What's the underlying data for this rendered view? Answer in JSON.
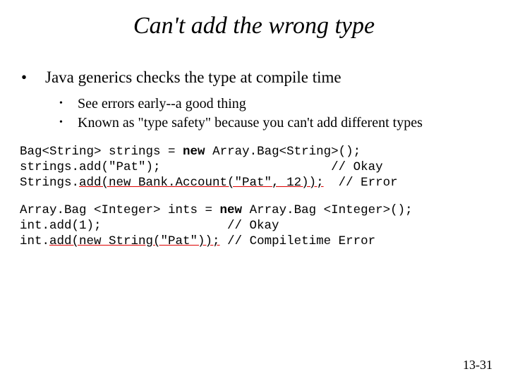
{
  "title": "Can't add the wrong type",
  "bullets": {
    "l1": "Java generics checks the type at compile time",
    "l2a": "See errors early--a good thing",
    "l2b": "Known as \"type safety\" because you can't add different types"
  },
  "code1": {
    "line1_a": "Bag<String> strings = ",
    "line1_kw": "new",
    "line1_b": " Array.Bag<String>();",
    "line2": "strings.add(\"Pat\");                       // Okay",
    "line3_a": "Strings.",
    "line3_err": "add(new Bank.Account(\"Pat\", 12));",
    "line3_b": "  // Error"
  },
  "code2": {
    "line1_a": "Array.Bag <Integer> ints = ",
    "line1_kw": "new",
    "line1_b": " Array.Bag <Integer>();",
    "line2": "int.add(1);                 // Okay",
    "line3_a": "int.",
    "line3_err": "add(new String(\"Pat\"));",
    "line3_b": " // Compiletime Error"
  },
  "footer": "13-31"
}
